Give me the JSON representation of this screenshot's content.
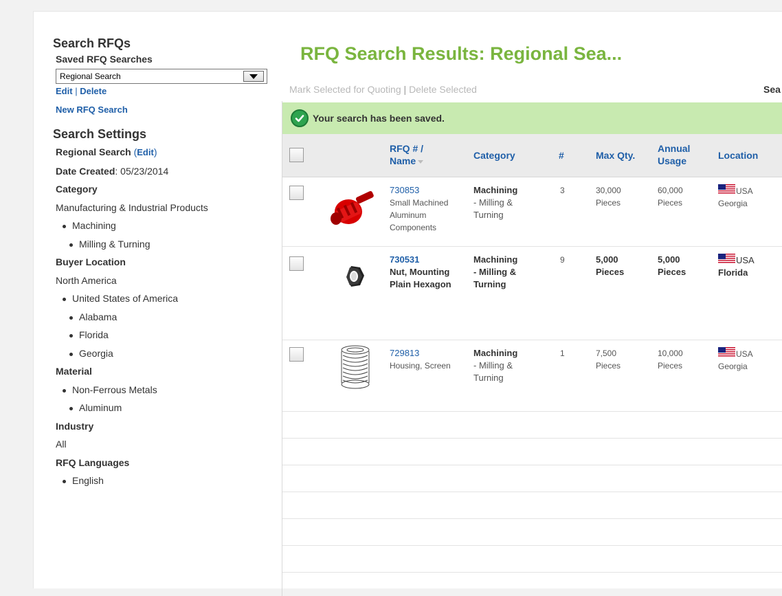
{
  "sidebar": {
    "title": "Search RFQs",
    "saved_label": "Saved RFQ Searches",
    "selected_search": "Regional Search",
    "edit_link": "Edit",
    "delete_link": "Delete",
    "link_sep": "|",
    "new_search_link": "New RFQ Search",
    "settings_title": "Search Settings",
    "search_name": "Regional Search",
    "search_name_edit": "Edit",
    "date_created_label": "Date Created",
    "date_created_value": "05/23/2014",
    "category_label": "Category",
    "category_root": "Manufacturing & Industrial Products",
    "category_l1": "Machining",
    "category_l2": "Milling & Turning",
    "buyer_location_label": "Buyer Location",
    "region": "North America",
    "country": "United States of America",
    "states": [
      "Alabama",
      "Florida",
      "Georgia"
    ],
    "material_label": "Material",
    "material_l1": "Non-Ferrous Metals",
    "material_l2": "Aluminum",
    "industry_label": "Industry",
    "industry_value": "All",
    "languages_label": "RFQ Languages",
    "language": "English"
  },
  "main": {
    "title": "RFQ Search Results: Regional Sea...",
    "mark_selected": "Mark Selected for Quoting",
    "action_sep": "|",
    "delete_selected": "Delete Selected",
    "search_cut": "Sea",
    "banner": "Your search has been saved.",
    "columns": {
      "rfq": "RFQ # /",
      "name": "Name",
      "category": "Category",
      "count": "#",
      "max_qty": "Max Qty.",
      "annual": "Annual",
      "usage": "Usage",
      "location": "Location"
    },
    "rows": [
      {
        "rfq": "730853",
        "name_1": "Small Machined",
        "name_2": "Aluminum",
        "name_3": "Components",
        "cat_1": "Machining",
        "cat_2": "- Milling &",
        "cat_3": "Turning",
        "count": "3",
        "max_qty": "30,000",
        "max_unit": "Pieces",
        "annual": "60,000",
        "annual_unit": "Pieces",
        "country": "USA",
        "state": "Georgia",
        "thumb": "red-aluminum-component"
      },
      {
        "rfq": "730531",
        "name_1": "Nut, Mounting",
        "name_2": "Plain Hexagon",
        "cat_1": "Machining",
        "cat_2": "- Milling &",
        "cat_3": "Turning",
        "count": "9",
        "max_qty": "5,000",
        "max_unit": "Pieces",
        "annual": "5,000",
        "annual_unit": "Pieces",
        "country": "USA",
        "state": "Florida",
        "thumb": "hex-nut"
      },
      {
        "rfq": "729813",
        "name_1": "Housing, Screen",
        "cat_1": "Machining",
        "cat_2": "- Milling &",
        "cat_3": "Turning",
        "count": "1",
        "max_qty": "7,500",
        "max_unit": "Pieces",
        "annual": "10,000",
        "annual_unit": "Pieces",
        "country": "USA",
        "state": "Georgia",
        "thumb": "screen-housing-sketch"
      }
    ]
  },
  "colors": {
    "title_green": "#7ab53f",
    "banner_green": "#c8eab0",
    "link_blue": "#1f5fa8",
    "success_green": "#2ea44f"
  },
  "icons": [
    "check-circle-icon",
    "dropdown-arrow-icon",
    "sort-arrow-icon",
    "us-flag-icon"
  ]
}
